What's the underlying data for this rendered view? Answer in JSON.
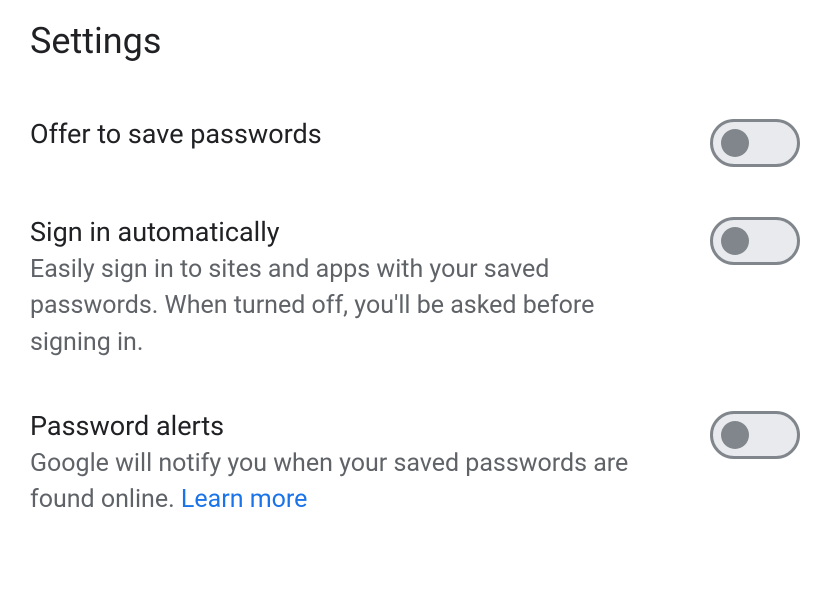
{
  "header": {
    "title": "Settings"
  },
  "settings": [
    {
      "title": "Offer to save passwords",
      "description": "",
      "learn_more": "",
      "toggle_on": false
    },
    {
      "title": "Sign in automatically",
      "description": "Easily sign in to sites and apps with your saved passwords. When turned off, you'll be asked before signing in.",
      "learn_more": "",
      "toggle_on": false
    },
    {
      "title": "Password alerts",
      "description": "Google will notify you when your saved passwords are found online. ",
      "learn_more": "Learn more",
      "toggle_on": false
    }
  ]
}
